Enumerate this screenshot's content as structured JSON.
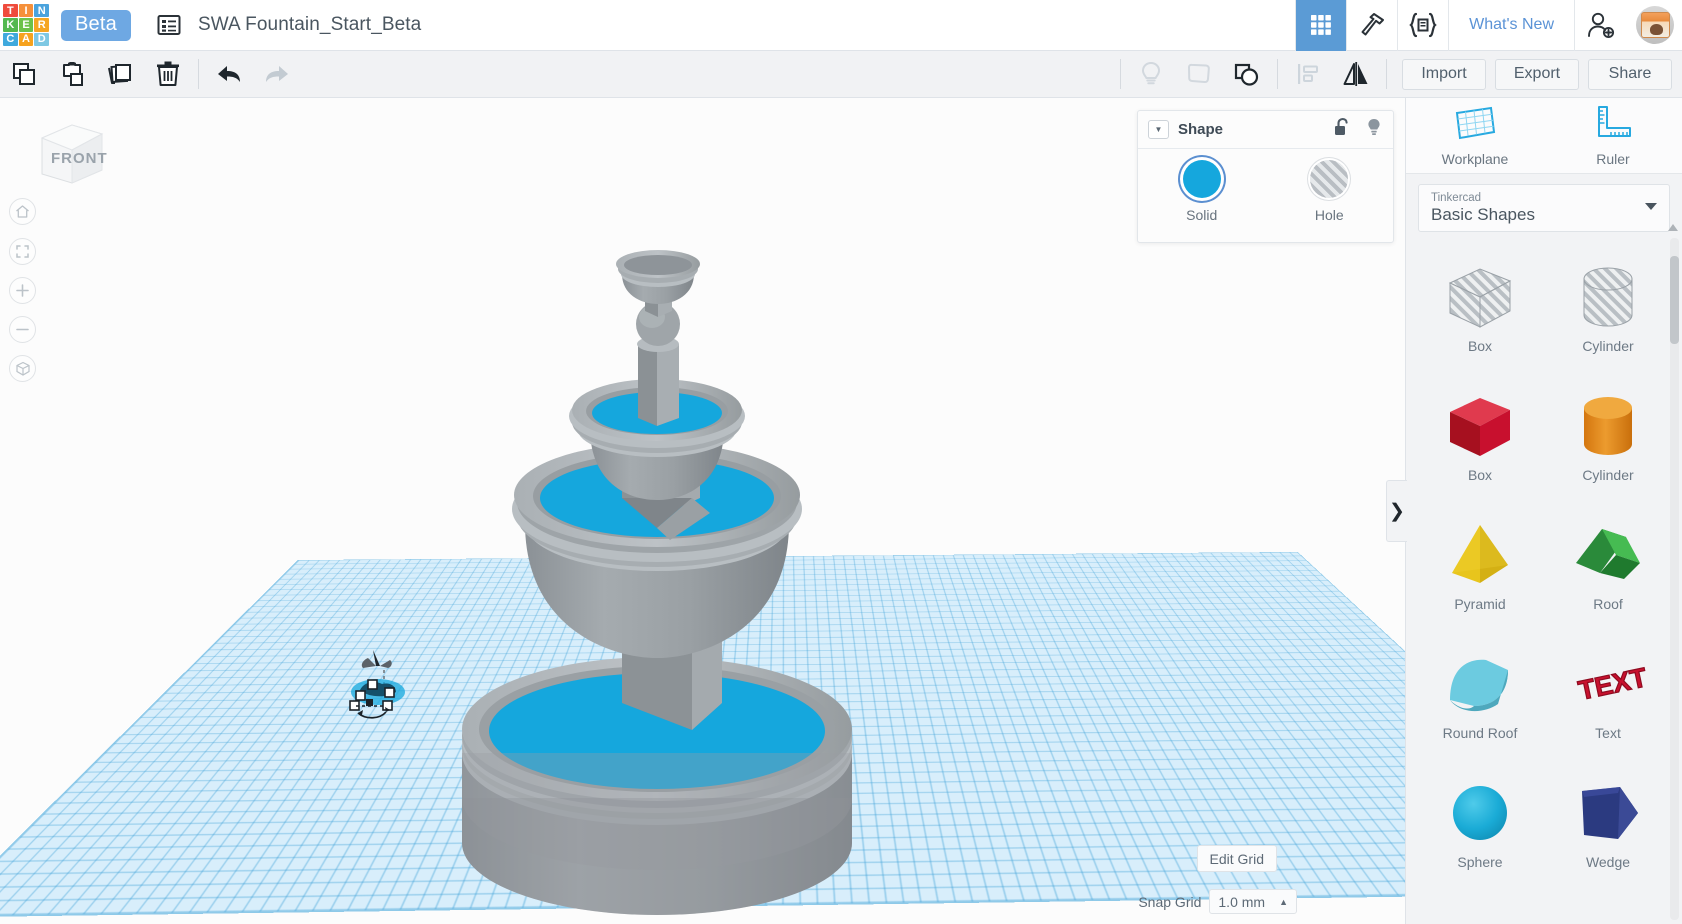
{
  "app": {
    "logo_letters": [
      "T",
      "I",
      "N",
      "K",
      "E",
      "R",
      "C",
      "A",
      "D"
    ],
    "logo_colors": [
      "#ef4b3c",
      "#f5903a",
      "#4aa3dd",
      "#53b84f",
      "#6cc24a",
      "#f5a623",
      "#3fa9dd",
      "#f6a21d",
      "#7ec8e3"
    ],
    "beta_label": "Beta",
    "document_title": "SWA Fountain_Start_Beta",
    "whats_new_label": "What's New",
    "accent_blue": "#5b9bd5",
    "water_blue": "#15a7dd"
  },
  "topbar_icons": {
    "document_list": "document-list-icon",
    "gallery": "grid-gallery-icon",
    "codeblocks": "hammer-icon",
    "code_brackets": "code-brackets-icon",
    "add_user": "add-user-icon",
    "avatar": "user-avatar"
  },
  "toolbar": {
    "copy": "Copy",
    "paste": "Paste",
    "duplicate": "Duplicate",
    "delete": "Delete",
    "undo": "Undo",
    "redo": "Redo",
    "light": "Light",
    "note": "Note",
    "group": "Group",
    "align": "Align",
    "mirror": "Mirror",
    "import_label": "Import",
    "export_label": "Export",
    "share_label": "Share"
  },
  "viewcube": {
    "face_label": "FRONT",
    "home": "home-icon",
    "fit_view": "fit-to-view-icon",
    "zoom_in": "+",
    "zoom_out": "−",
    "ortho_toggle": "orthographic-toggle-icon"
  },
  "shape_panel": {
    "title": "Shape",
    "lock_icon": "unlock-icon",
    "light_icon": "lightbulb-icon",
    "solid_label": "Solid",
    "hole_label": "Hole",
    "selected": "Solid"
  },
  "sidebar": {
    "tools": [
      {
        "label": "Workplane",
        "icon": "workplane-icon"
      },
      {
        "label": "Ruler",
        "icon": "ruler-icon"
      }
    ],
    "library_source": "Tinkercad",
    "library_name": "Basic Shapes",
    "shapes": [
      {
        "label": "Box",
        "kind": "hole-box"
      },
      {
        "label": "Cylinder",
        "kind": "hole-cylinder"
      },
      {
        "label": "Box",
        "kind": "box",
        "color": "#c8102e"
      },
      {
        "label": "Cylinder",
        "kind": "cylinder",
        "color": "#e8891c"
      },
      {
        "label": "Pyramid",
        "kind": "pyramid",
        "color": "#e8c51c"
      },
      {
        "label": "Roof",
        "kind": "roof",
        "color": "#36a847"
      },
      {
        "label": "Round Roof",
        "kind": "round-roof",
        "color": "#5bc0d8"
      },
      {
        "label": "Text",
        "kind": "text",
        "color": "#c8102e"
      },
      {
        "label": "Sphere",
        "kind": "sphere",
        "color": "#14a7d4"
      },
      {
        "label": "Wedge",
        "kind": "wedge",
        "color": "#2b3a80"
      }
    ],
    "collapse_label": "❯"
  },
  "canvas_footer": {
    "edit_grid_label": "Edit Grid",
    "snap_grid_label": "Snap Grid",
    "snap_grid_value": "1.0 mm"
  },
  "model": {
    "name": "three-tier-fountain",
    "stone_color": "#9ea4a8",
    "water_color": "#15a7dd"
  }
}
